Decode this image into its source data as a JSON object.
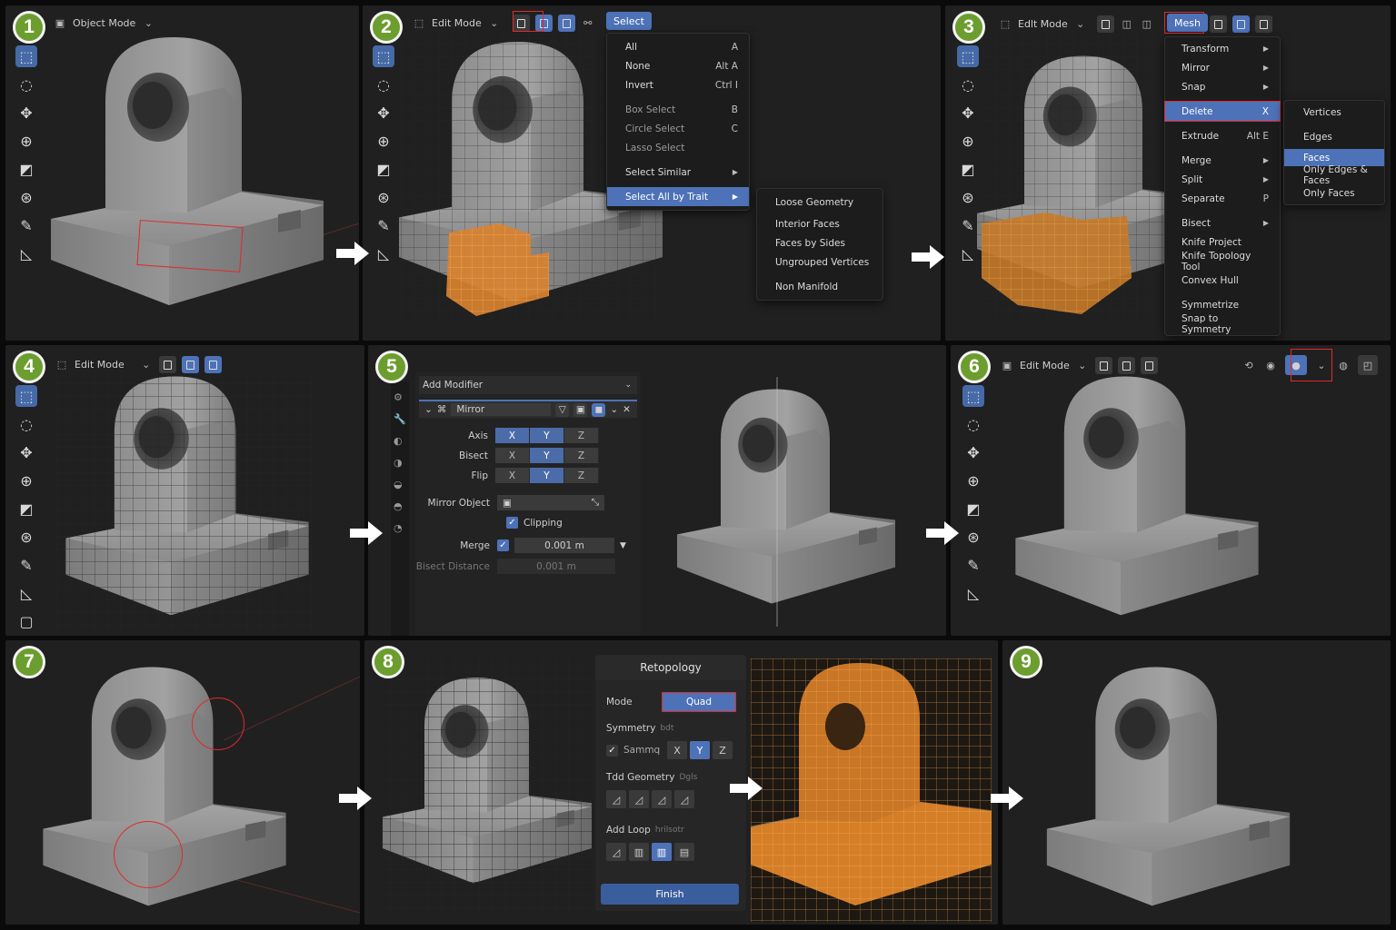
{
  "steps": [
    "1",
    "2",
    "3",
    "4",
    "5",
    "6",
    "7",
    "8",
    "9"
  ],
  "header": {
    "object_mode": "Object Mode",
    "edit_mode": "Edit Mode",
    "edit_mode_alt": "Edlt Mode",
    "select_tab": "Select",
    "mesh_tab": "Mesh"
  },
  "select_menu": {
    "items": [
      {
        "label": "All",
        "shortcut": "A"
      },
      {
        "label": "None",
        "shortcut": "Alt A"
      },
      {
        "label": "Invert",
        "shortcut": "Ctrl I"
      },
      {
        "label": "Box Select",
        "shortcut": "B"
      },
      {
        "label": "Circle Select",
        "shortcut": "C"
      },
      {
        "label": "Lasso Select",
        "shortcut": ""
      },
      {
        "label": "Select Similar",
        "shortcut": ""
      },
      {
        "label": "Select All by Trait",
        "shortcut": ""
      }
    ],
    "sub": [
      "Loose Geometry",
      "Interior Faces",
      "Faces by Sides",
      "Ungrouped Vertices",
      "Non Manifold"
    ]
  },
  "mesh_menu": {
    "items": [
      {
        "label": "Transform",
        "shortcut": ""
      },
      {
        "label": "Mirror",
        "shortcut": ""
      },
      {
        "label": "Snap",
        "shortcut": ""
      },
      {
        "label": "Delete",
        "shortcut": "X"
      },
      {
        "label": "Extrude",
        "shortcut": "Alt E"
      },
      {
        "label": "Merge",
        "shortcut": ""
      },
      {
        "label": "Split",
        "shortcut": ""
      },
      {
        "label": "Separate",
        "shortcut": "P"
      },
      {
        "label": "Bisect",
        "shortcut": ""
      },
      {
        "label": "Knife Project",
        "shortcut": ""
      },
      {
        "label": "Knife Topology Tool",
        "shortcut": ""
      },
      {
        "label": "Convex Hull",
        "shortcut": ""
      },
      {
        "label": "Symmetrize",
        "shortcut": ""
      },
      {
        "label": "Snap to Symmetry",
        "shortcut": ""
      }
    ],
    "delete_sub": [
      "Vertices",
      "Edges",
      "Faces",
      "Only Edges & Faces",
      "Only Faces"
    ]
  },
  "modifier": {
    "add": "Add Modifier",
    "name": "Mirror",
    "axis": "Axis",
    "bisect": "Bisect",
    "flip": "Flip",
    "xyz": [
      "X",
      "Y",
      "Z"
    ],
    "mirror_object": "Mirror Object",
    "clipping": "Clipping",
    "merge": "Merge",
    "merge_val": "0.001 m",
    "bisect_distance": "Bisect Distance",
    "bisect_val": "0.001 m"
  },
  "retopo": {
    "title": "Retopology",
    "mode": "Mode",
    "mode_val": "Quad",
    "symmetry": "Symmetry",
    "symmetry_hint": "bdt",
    "symmetry_chk": "Sammq",
    "xyz": [
      "X",
      "Y",
      "Z"
    ],
    "tdd": "Tdd Geometry",
    "tdd_hint": "Dgls",
    "add_loop": "Add Loop",
    "add_loop_hint": "hrilsotr",
    "finish": "Finish"
  },
  "colors": {
    "accent": "#4e72b8",
    "badge": "#6c9d2f",
    "highlight": "#e02a2a",
    "selection": "#e88a2a"
  }
}
